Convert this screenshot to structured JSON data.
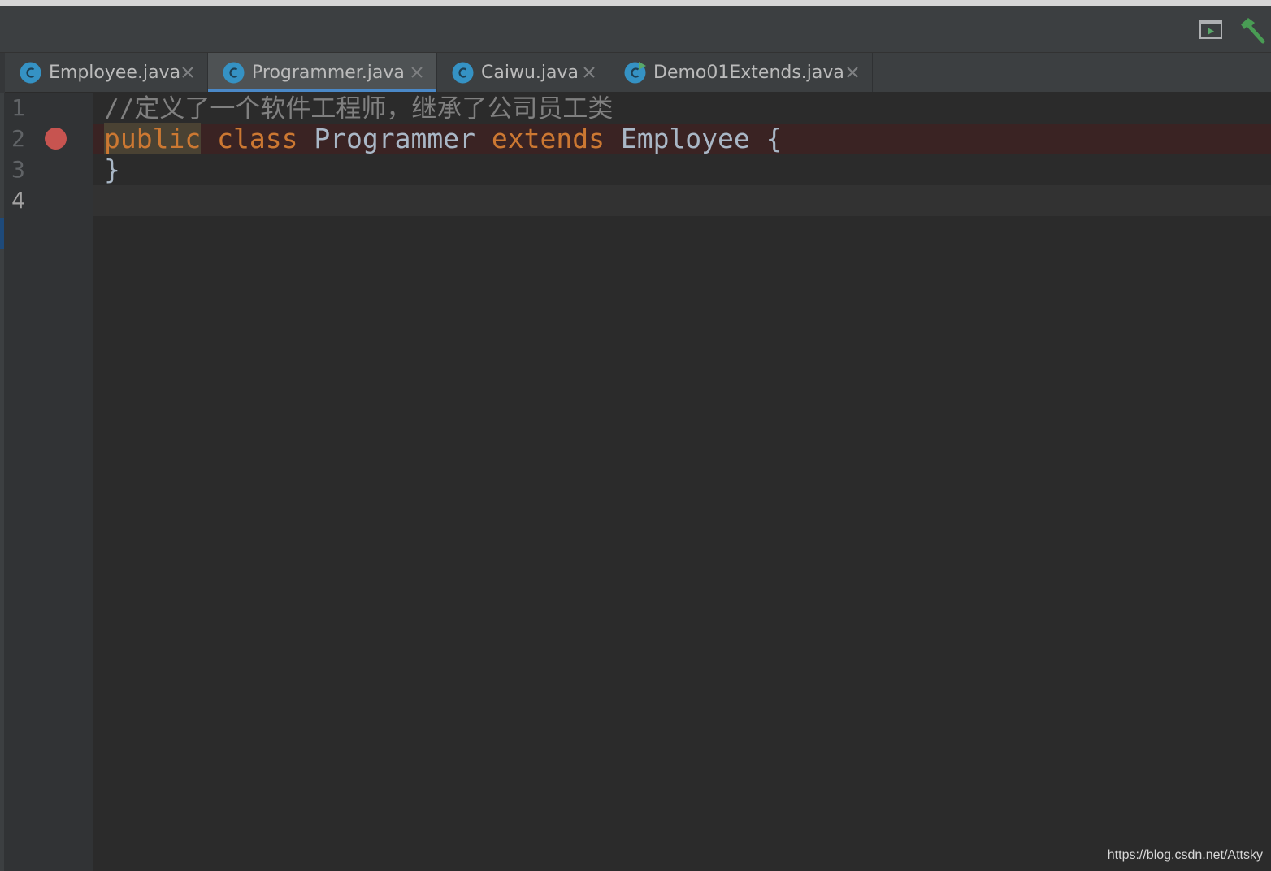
{
  "toolbar": {
    "icons": [
      "run-window-icon",
      "build-hammer-icon"
    ]
  },
  "tabs": [
    {
      "label": "Employee.java",
      "icon": "java-class-icon",
      "active": false
    },
    {
      "label": "Programmer.java",
      "icon": "java-class-icon",
      "active": true
    },
    {
      "label": "Caiwu.java",
      "icon": "java-class-icon",
      "active": false
    },
    {
      "label": "Demo01Extends.java",
      "icon": "java-runnable-class-icon",
      "active": false
    }
  ],
  "editor": {
    "line_numbers": [
      "1",
      "2",
      "3",
      "4"
    ],
    "current_line": "4",
    "breakpoint_line": "2",
    "lines": [
      {
        "comment": "//定义了一个软件工程师，继承了公司员工类"
      },
      {
        "kw_public": "public",
        "kw_class": "class",
        "class_name": "Programmer",
        "kw_extends": "extends",
        "parent_name": "Employee",
        "brace_open": "{"
      },
      {
        "brace_close": "}"
      },
      {
        "text": ""
      }
    ]
  },
  "colors": {
    "keyword": "#cc7832",
    "comment": "#808080",
    "identifier": "#a9b7c6",
    "breakpoint": "#c75450",
    "active_tab_underline": "#4a88c7",
    "editor_background": "#2b2b2b"
  },
  "watermark": "https://blog.csdn.net/Attsky"
}
